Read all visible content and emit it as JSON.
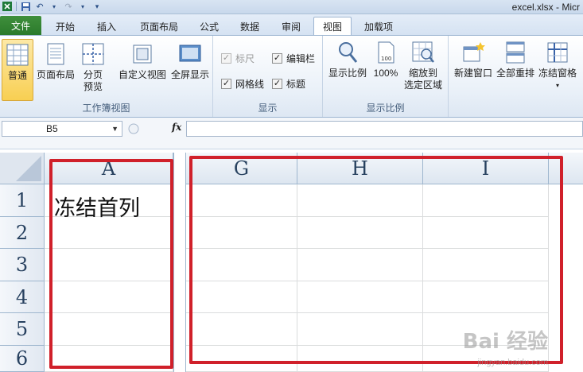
{
  "window": {
    "title": "excel.xlsx - Micr"
  },
  "ribbon_tabs": {
    "file": "文件",
    "home": "开始",
    "insert": "插入",
    "page_layout": "页面布局",
    "formulas": "公式",
    "data": "数据",
    "review": "审阅",
    "view": "视图",
    "addins": "加载项"
  },
  "workbook_views": {
    "normal": "普通",
    "page_layout": "页面布局",
    "page_break_1": "分页",
    "page_break_2": "预览",
    "custom_views": "自定义视图",
    "full_screen": "全屏显示",
    "label": "工作簿视图"
  },
  "show": {
    "ruler": "标尺",
    "formula_bar": "编辑栏",
    "gridlines": "网格线",
    "headings": "标题",
    "label": "显示"
  },
  "zoom": {
    "zoom": "显示比例",
    "hundred": "100%",
    "zoom_sel_1": "缩放到",
    "zoom_sel_2": "选定区域",
    "label": "显示比例"
  },
  "window_group": {
    "new_window": "新建窗口",
    "arrange_all": "全部重排",
    "freeze": "冻结窗格"
  },
  "formula_bar": {
    "name_box": "B5",
    "fx": "fx",
    "content": ""
  },
  "sheet": {
    "columns": [
      "A",
      "G",
      "H",
      "I"
    ],
    "rows": [
      "1",
      "2",
      "3",
      "4",
      "5",
      "6"
    ],
    "A1": "冻结首列"
  },
  "watermark": {
    "brand": "Bai 经验",
    "url": "jingyan.baidu.com"
  },
  "colors": {
    "highlight": "#d0202a",
    "file_tab": "#2b7a2b",
    "active_button": "#f8cf52"
  }
}
